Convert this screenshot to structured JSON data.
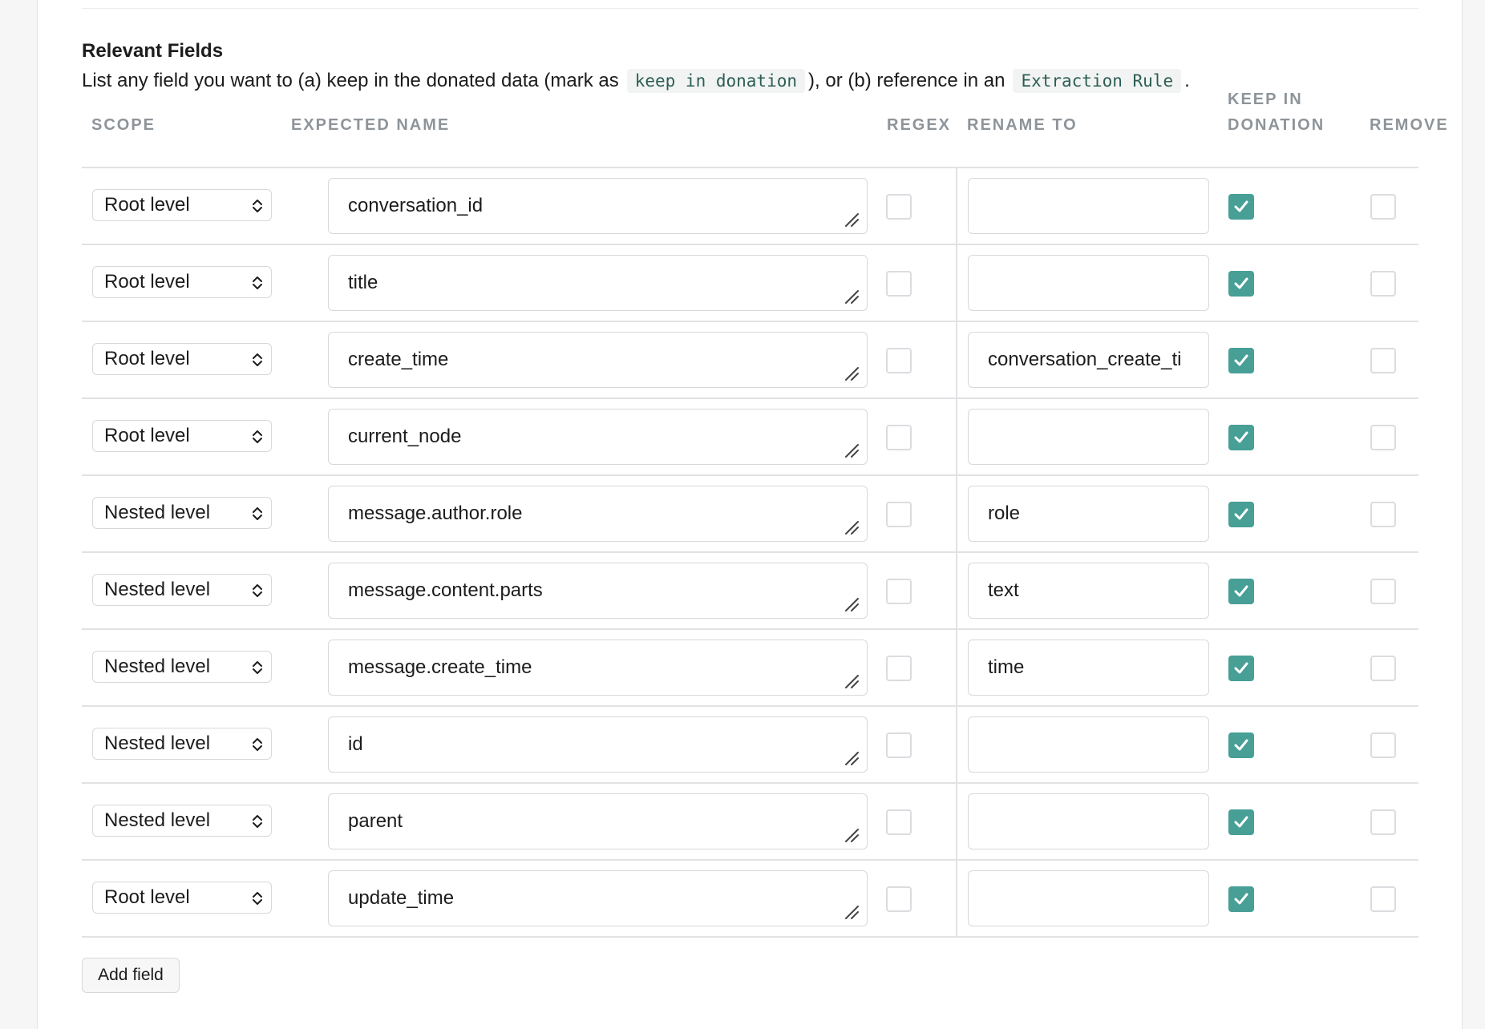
{
  "section": {
    "title": "Relevant Fields",
    "desc_part1": "List any field you want to (a) keep in the donated data (mark as",
    "desc_code1": "keep in donation",
    "desc_part2": "), or (b) reference in an",
    "desc_code2": "Extraction Rule",
    "desc_part3": "."
  },
  "table": {
    "headers": {
      "scope": "SCOPE",
      "expected_name": "EXPECTED NAME",
      "regex": "REGEX",
      "rename_to": "RENAME TO",
      "keep_line1": "KEEP IN",
      "keep_line2": "DONATION",
      "remove": "REMOVE"
    },
    "rows": [
      {
        "scope": "Root level",
        "name": "conversation_id",
        "regex": false,
        "rename": "",
        "keep": true,
        "remove": false
      },
      {
        "scope": "Root level",
        "name": "title",
        "regex": false,
        "rename": "",
        "keep": true,
        "remove": false
      },
      {
        "scope": "Root level",
        "name": "create_time",
        "regex": false,
        "rename": "conversation_create_ti",
        "keep": true,
        "remove": false
      },
      {
        "scope": "Root level",
        "name": "current_node",
        "regex": false,
        "rename": "",
        "keep": true,
        "remove": false
      },
      {
        "scope": "Nested level",
        "name": "message.author.role",
        "regex": false,
        "rename": "role",
        "keep": true,
        "remove": false
      },
      {
        "scope": "Nested level",
        "name": "message.content.parts",
        "regex": false,
        "rename": "text",
        "keep": true,
        "remove": false
      },
      {
        "scope": "Nested level",
        "name": "message.create_time",
        "regex": false,
        "rename": "time",
        "keep": true,
        "remove": false
      },
      {
        "scope": "Nested level",
        "name": "id",
        "regex": false,
        "rename": "",
        "keep": true,
        "remove": false
      },
      {
        "scope": "Nested level",
        "name": "parent",
        "regex": false,
        "rename": "",
        "keep": true,
        "remove": false
      },
      {
        "scope": "Root level",
        "name": "update_time",
        "regex": false,
        "rename": "",
        "keep": true,
        "remove": false
      }
    ]
  },
  "add_button": {
    "label": "Add field"
  },
  "colors": {
    "accent": "#479f96",
    "code_text": "#2d5e54",
    "header_text": "#8e9499"
  }
}
